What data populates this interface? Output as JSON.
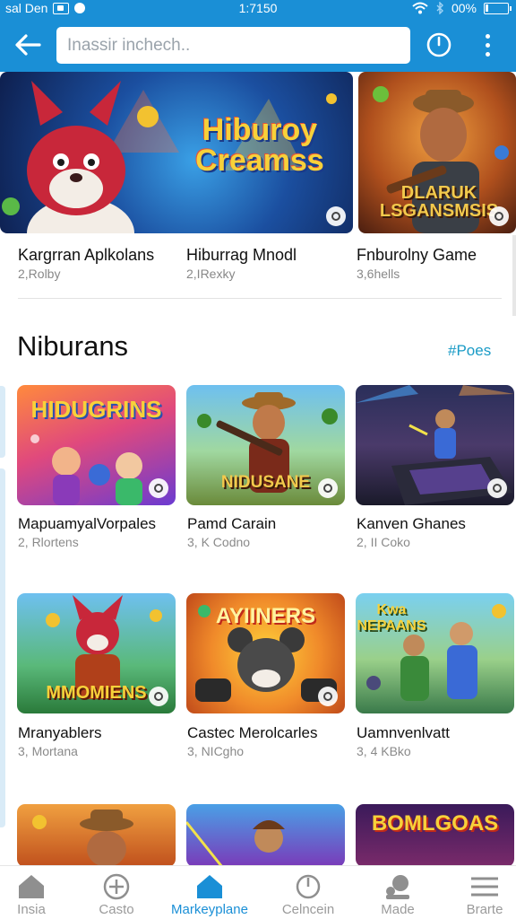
{
  "status_bar": {
    "carrier": "sal Den",
    "time": "1:7150",
    "battery": "00%"
  },
  "app_bar": {
    "back_icon": "arrow-left-icon",
    "search_placeholder": "Inassir inchech..",
    "timer_icon": "timer-icon",
    "more_icon": "more-vertical-icon"
  },
  "featured": [
    {
      "title": "Kargrran Aplkolans",
      "sub": "2,Rolby",
      "art_text": "Hiburoy Creamss"
    },
    {
      "title": "Hiburrag Mnodl",
      "sub": "2,IRexky"
    },
    {
      "title": "Fnburolny Game",
      "sub": "3,6hells",
      "art_text": "DLARUK LSGANSMSIS"
    }
  ],
  "section": {
    "title": "Niburans",
    "link": "#Poes"
  },
  "games": [
    {
      "name": "MapuamyalVorpales",
      "sub": "2, Rlortens",
      "art_text": "HIDUGRINS"
    },
    {
      "name": "Pamd Carain",
      "sub": "3, K Codno",
      "art_text": "NIDUSANE"
    },
    {
      "name": "Kanven Ghanes",
      "sub": "2, II Coko"
    },
    {
      "name": "Mranyablers",
      "sub": "3, Mortana",
      "art_text": "MMOMIENS"
    },
    {
      "name": "Castec Merolcarles",
      "sub": "3, NICgho",
      "art_text": "AYIINERS"
    },
    {
      "name": "Uamnvenlvatt",
      "sub": "3, 4 KBko",
      "art_text": "Kwa NEPAANS"
    },
    {
      "name": "",
      "sub": ""
    },
    {
      "name": "",
      "sub": ""
    },
    {
      "name": "",
      "sub": "",
      "art_text": "BOMLGOAS"
    }
  ],
  "bottom_nav": [
    {
      "label": "Insia",
      "icon": "home-icon",
      "active": false
    },
    {
      "label": "Casto",
      "icon": "plus-circle-icon",
      "active": false
    },
    {
      "label": "Markeyplane",
      "icon": "home-icon",
      "active": true
    },
    {
      "label": "Celncein",
      "icon": "power-icon",
      "active": false
    },
    {
      "label": "Made",
      "icon": "face-location-icon",
      "active": false
    },
    {
      "label": "Brarte",
      "icon": "menu-icon",
      "active": false
    }
  ],
  "colors": {
    "primary": "#1a8fd6",
    "link": "#1a9bc6",
    "active_tab": "#1a8fd6"
  }
}
